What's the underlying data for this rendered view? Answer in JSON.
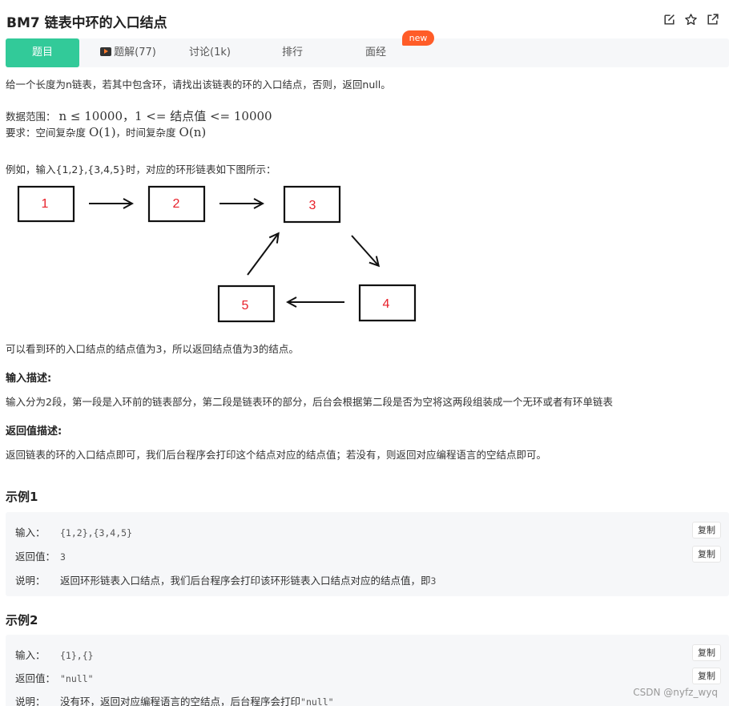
{
  "header": {
    "title": "BM7  链表中环的入口结点"
  },
  "tabs": [
    {
      "label": "题目"
    },
    {
      "label": "题解(77)"
    },
    {
      "label": "讨论(1k)"
    },
    {
      "label": "排行"
    },
    {
      "label": "面经"
    }
  ],
  "new_badge": "new",
  "description": {
    "intro": "给一个长度为n链表，若其中包含环，请找出该链表的环的入口结点，否则，返回null。",
    "range_label": "数据范围：",
    "range_math": "n ≤ 10000，1 <= 结点值 <= 10000",
    "req_label": "要求：空间复杂度",
    "req_space": "O(1)",
    "req_mid": "，时间复杂度",
    "req_time": "O(n)",
    "example_intro": "例如，输入{1,2},{3,4,5}时，对应的环形链表如下图所示：",
    "conclusion": "可以看到环的入口结点的结点值为3，所以返回结点值为3的结点。"
  },
  "diagram": {
    "nodes": [
      "1",
      "2",
      "3",
      "4",
      "5"
    ]
  },
  "input_desc": {
    "heading": "输入描述:",
    "text": "输入分为2段，第一段是入环前的链表部分，第二段是链表环的部分，后台会根据第二段是否为空将这两段组装成一个无环或者有环单链表"
  },
  "return_desc": {
    "heading": "返回值描述:",
    "text": "返回链表的环的入口结点即可，我们后台程序会打印这个结点对应的结点值；若没有，则返回对应编程语言的空结点即可。"
  },
  "examples": [
    {
      "title": "示例1",
      "input_label": "输入：",
      "input": "{1,2},{3,4,5}",
      "return_label": "返回值：",
      "return": "3",
      "explain_label": "说明：",
      "explain": "返回环形链表入口结点，我们后台程序会打印该环形链表入口结点对应的结点值，即",
      "explain_code": "3"
    },
    {
      "title": "示例2",
      "input_label": "输入：",
      "input": "{1},{}",
      "return_label": "返回值：",
      "return": "\"null\"",
      "explain_label": "说明：",
      "explain": "没有环，返回对应编程语言的空结点，后台程序会打印",
      "explain_code": "\"null\""
    }
  ],
  "copy_label": "复制",
  "watermark": "CSDN @nyfz_wyq",
  "icons": [
    "edit-icon",
    "star-icon",
    "share-icon"
  ],
  "colors": {
    "accent": "#32ca99",
    "badge": "#ff5c28",
    "node_text": "#e8202a"
  }
}
